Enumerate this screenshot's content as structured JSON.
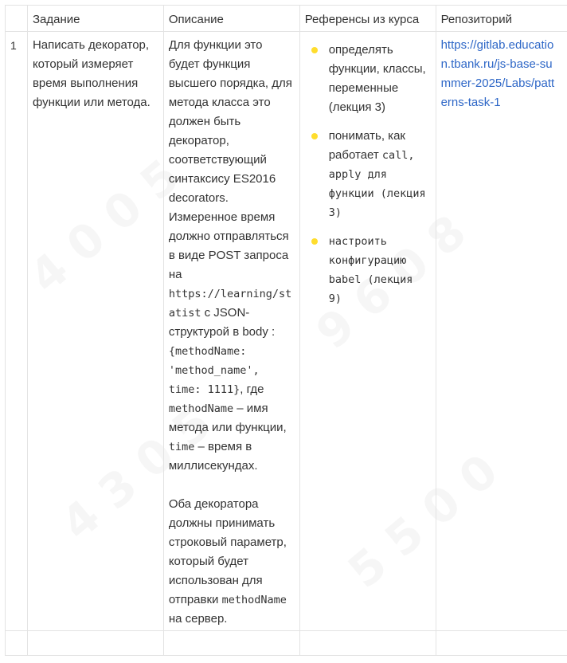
{
  "table": {
    "headers": [
      "",
      "Задание",
      "Описание",
      "Референсы из курса",
      "Репозиторий"
    ],
    "rows": [
      {
        "number": "1",
        "task": "Написать декоратор, который измеряет время выполнения функции или метода.",
        "description": {
          "p1_a": "Для функции это будет функция высшего порядка, для метода класса это должен быть декоратор, соответствующий синтаксису ES2016 decorators. Измеренное время должно отправляться в виде POST запроса на ",
          "url_code": "https://learning/statist",
          "p1_b": " с JSON-структурой в body : ",
          "json_code": "{methodName: 'method_name', time: 1111}",
          "p1_c": ", где ",
          "method_code": "methodName",
          "p1_d": " – имя метода или функции, ",
          "time_code": "time",
          "p1_e": " – время в миллисекундах.",
          "p2_a": "Оба декоратора должны принимать строковый параметр, который будет использован для отправки ",
          "p2_code": "methodName",
          "p2_b": " на сервер."
        },
        "references": [
          {
            "text": "определять функции, классы, переменные (лекция 3)"
          },
          {
            "text_a": "понимать, как работает ",
            "code": "call, apply для функции (лекция 3)"
          },
          {
            "code": "настроить конфигурацию babel (лекция 9)"
          }
        ],
        "repository": "https://gitlab.education.tbank.ru/js-base-summer-2025/Labs/patterns-task-1"
      }
    ]
  },
  "colors": {
    "link": "#2e67c7",
    "bullet": "#ffdd2d",
    "border": "#e3e3e3",
    "text": "#333333"
  }
}
